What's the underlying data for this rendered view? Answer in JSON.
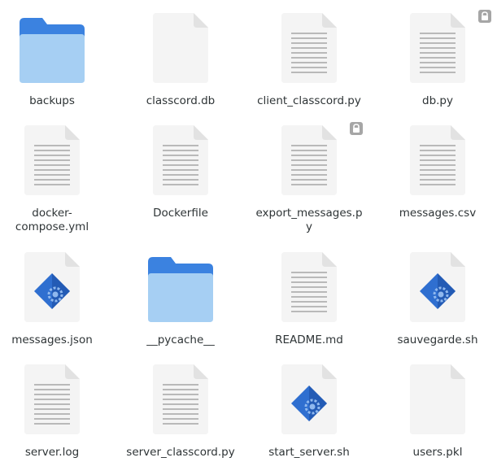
{
  "files": [
    {
      "name": "backups",
      "kind": "folder",
      "locked": false
    },
    {
      "name": "classcord.db",
      "kind": "blank",
      "locked": false
    },
    {
      "name": "client_classcord.py",
      "kind": "text",
      "locked": false
    },
    {
      "name": "db.py",
      "kind": "text",
      "locked": true
    },
    {
      "name": "docker-compose.yml",
      "kind": "text",
      "locked": false,
      "label_lines": [
        "docker-",
        "compose.yml"
      ]
    },
    {
      "name": "Dockerfile",
      "kind": "text",
      "locked": false
    },
    {
      "name": "export_messages.py",
      "kind": "text",
      "locked": true,
      "label_lines": [
        "export_messages.p",
        "y"
      ]
    },
    {
      "name": "messages.csv",
      "kind": "text",
      "locked": false
    },
    {
      "name": "messages.json",
      "kind": "script",
      "locked": false
    },
    {
      "name": "__pycache__",
      "kind": "folder",
      "locked": false
    },
    {
      "name": "README.md",
      "kind": "text",
      "locked": false
    },
    {
      "name": "sauvegarde.sh",
      "kind": "script",
      "locked": false
    },
    {
      "name": "server.log",
      "kind": "text",
      "locked": false
    },
    {
      "name": "server_classcord.py",
      "kind": "text",
      "locked": false
    },
    {
      "name": "start_server.sh",
      "kind": "script",
      "locked": false
    },
    {
      "name": "users.pkl",
      "kind": "blank",
      "locked": false
    }
  ],
  "colors": {
    "folder_back": "#3b82e0",
    "folder_front": "#a6cff3",
    "page": "#f4f4f4",
    "page_fold": "#e2e2e2",
    "page_lines": "#b9b9b9",
    "script_blue": "#2f6fd0",
    "script_dark": "#1a4a9e",
    "lock": "#a6a6a6",
    "label": "#2e3436"
  },
  "icons": {
    "folder": "folder-icon",
    "text": "text-file-icon",
    "blank": "blank-file-icon",
    "script": "script-file-icon",
    "lock": "lock-icon"
  }
}
